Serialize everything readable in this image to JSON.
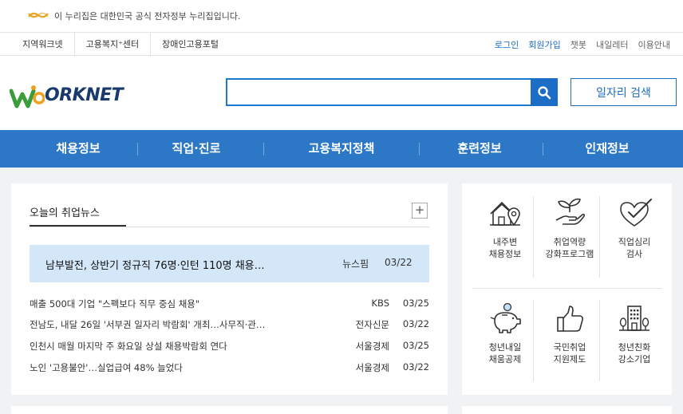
{
  "gov_notice": {
    "text": "이 누리집은 대한민국 공식 전자정부 누리집입니다.",
    "logo_icon": "government-symbol-icon",
    "logo_color": "#e5a52a"
  },
  "utility_nav": {
    "left": [
      "지역워크넷",
      "고용복지⁺센터",
      "장애인고용포털"
    ],
    "right": [
      "로그인",
      "회원가입",
      "챗봇",
      "내일레터",
      "이용안내"
    ]
  },
  "header": {
    "logo_text": "ORKNET",
    "logo_icon": "worknet-w-logo-icon",
    "search_placeholder": "",
    "search_icon": "search-icon",
    "job_search_label": "일자리 검색",
    "accent_color": "#1c6dc6"
  },
  "main_nav": {
    "items": [
      "채용정보",
      "직업·진로",
      "고용복지정책",
      "훈련정보",
      "인재정보"
    ],
    "bg_color": "#2c78c7"
  },
  "news": {
    "title": "오늘의 취업뉴스",
    "more_label": "+",
    "highlight": {
      "title": "남부발전, 상반기 정규직 76명·인턴 110명 채용…",
      "source": "뉴스핌",
      "date": "03/22"
    },
    "items": [
      {
        "title": "매출 500대 기업 \"스펙보다 직무 중심 채용\"",
        "source": "KBS",
        "date": "03/25"
      },
      {
        "title": "전남도, 내달 26일 '서부권 일자리 박람회' 개최…사무직·관…",
        "source": "전자신문",
        "date": "03/22"
      },
      {
        "title": "인천시 매월 마지막 주 화요일 상설 채용박람회 연다",
        "source": "서울경제",
        "date": "03/25"
      },
      {
        "title": "노인 '고용불안'…실업급여 48% 늘었다",
        "source": "서울경제",
        "date": "03/22"
      }
    ]
  },
  "services": [
    {
      "label": "내주변\n채용정보",
      "icon": "house-location-icon"
    },
    {
      "label": "취업역량\n강화프로그램",
      "icon": "hand-sprout-icon"
    },
    {
      "label": "직업심리\n검사",
      "icon": "heart-check-icon"
    },
    {
      "label": "청년내일\n채움공제",
      "icon": "piggy-bank-icon"
    },
    {
      "label": "국민취업\n지원제도",
      "icon": "thumbs-up-icon"
    },
    {
      "label": "청년친화\n강소기업",
      "icon": "building-trees-icon"
    }
  ]
}
